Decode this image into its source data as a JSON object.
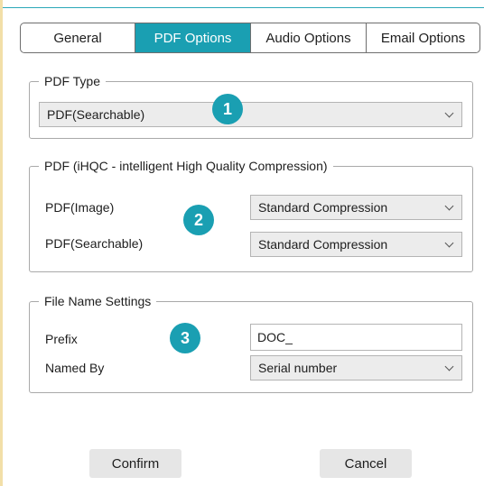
{
  "tabs": [
    {
      "label": "General"
    },
    {
      "label": "PDF Options"
    },
    {
      "label": "Audio Options"
    },
    {
      "label": "Email Options"
    }
  ],
  "active_tab": "PDF Options",
  "pdf_type": {
    "legend": "PDF Type",
    "selected": "PDF(Searchable)"
  },
  "ihqc": {
    "legend": "PDF (iHQC - intelligent High Quality Compression)",
    "image_label": "PDF(Image)",
    "image_value": "Standard Compression",
    "searchable_label": "PDF(Searchable)",
    "searchable_value": "Standard Compression"
  },
  "file_name": {
    "legend": "File Name Settings",
    "prefix_label": "Prefix",
    "prefix_value": "DOC_",
    "named_by_label": "Named By",
    "named_by_value": "Serial number"
  },
  "badges": [
    "1",
    "2",
    "3"
  ],
  "buttons": {
    "confirm": "Confirm",
    "cancel": "Cancel"
  },
  "colors": {
    "accent": "#1a9fb2"
  }
}
